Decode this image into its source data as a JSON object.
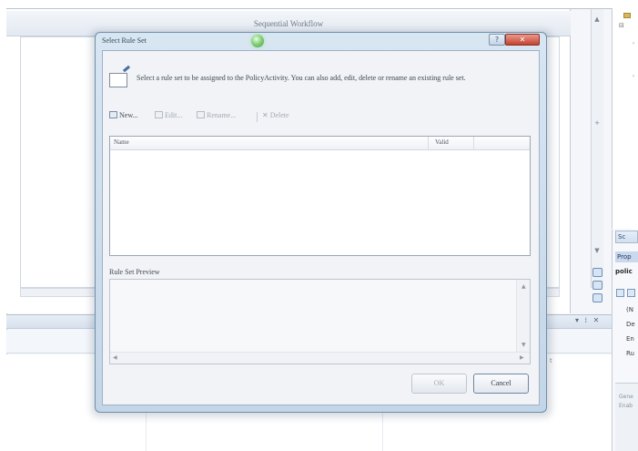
{
  "ide": {
    "designer_title": "Sequential Workflow",
    "bottom_pane_controls": "▾ ⁞ ✕",
    "peek_text": "t",
    "solution_tree": [
      "⊟",
      "◦",
      "◦"
    ],
    "properties": {
      "tab_label": "Sc",
      "title": "Prop",
      "object_name": "polic",
      "rows": [
        "(N",
        "De",
        "En",
        "Ru"
      ],
      "description": [
        "Gene",
        "Enab"
      ]
    }
  },
  "dialog": {
    "title": "Select Rule Set",
    "help_glyph": "?",
    "close_glyph": "✕",
    "instruction": "Select a rule set to be assigned to the PolicyActivity. You can also add, edit, delete or rename an existing rule set.",
    "toolbar": {
      "new": "New...",
      "edit": "Edit...",
      "rename": "Rename...",
      "delete": "Delete"
    },
    "list": {
      "columns": [
        "Name",
        "Valid"
      ],
      "rows": []
    },
    "preview_label": "Rule Set Preview",
    "buttons": {
      "ok": "OK",
      "cancel": "Cancel"
    }
  },
  "colors": {
    "dialog_frame": "#c3d6e8",
    "close_button": "#c5432f",
    "accent": "#88d07d"
  }
}
